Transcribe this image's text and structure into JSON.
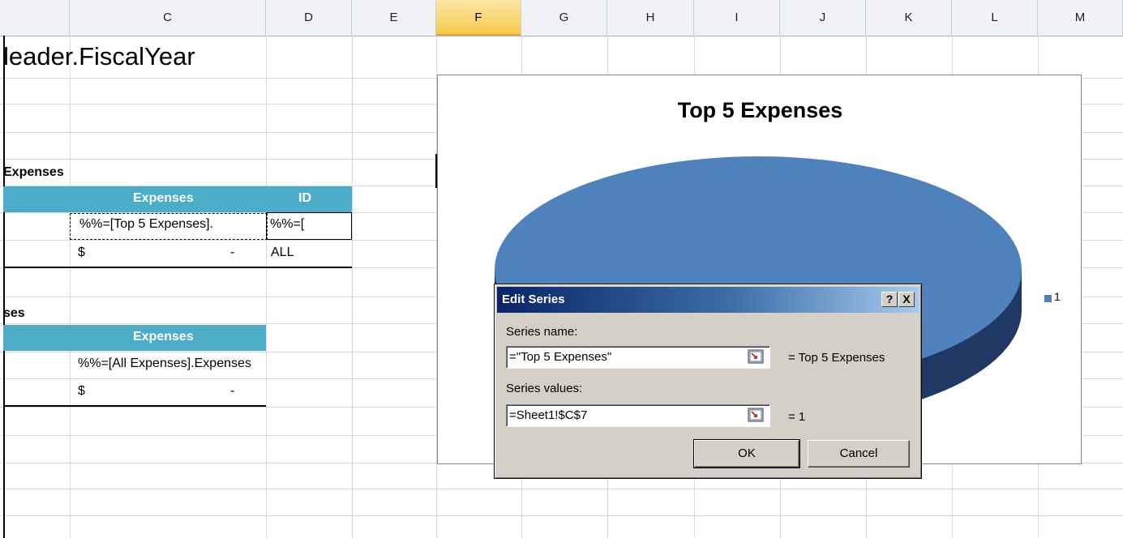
{
  "columns": [
    "C",
    "D",
    "E",
    "F",
    "G",
    "H",
    "I",
    "J",
    "K",
    "L",
    "M"
  ],
  "selected_column": "F",
  "cells": {
    "fiscal_year": "leader.FiscalYear",
    "section1_title": "Expenses",
    "section1_header_expenses": "Expenses",
    "section1_header_id": "ID",
    "section1_formula_expenses": "%%=[Top 5 Expenses].",
    "section1_formula_id": "%%=[",
    "section1_currency": "$",
    "section1_dash": "-",
    "section1_id_value": "ALL",
    "section2_title": "ses",
    "section2_header_expenses": "Expenses",
    "section2_formula": "%%=[All Expenses].Expenses",
    "section2_currency": "$",
    "section2_dash": "-"
  },
  "chart": {
    "title": "Top 5 Expenses",
    "legend_label": "1",
    "series_color": "#4f81bd"
  },
  "chart_data": {
    "type": "pie",
    "title": "Top 5 Expenses",
    "labels": [
      "1"
    ],
    "values": [
      1
    ],
    "legend": "right"
  },
  "dialog": {
    "title": "Edit Series",
    "help_button": "?",
    "close_button": "X",
    "series_name_label": "Series name:",
    "series_name_value": "=\"Top 5 Expenses\"",
    "series_name_result": "= Top 5 Expenses",
    "series_values_label": "Series values:",
    "series_values_value": "=Sheet1!$C$7",
    "series_values_result": "= 1",
    "ok_label": "OK",
    "cancel_label": "Cancel"
  },
  "colors": {
    "table_header": "#4cadc9",
    "selected_column_header": "#f7c94c",
    "dialog_titlebar": "#0a246a"
  }
}
